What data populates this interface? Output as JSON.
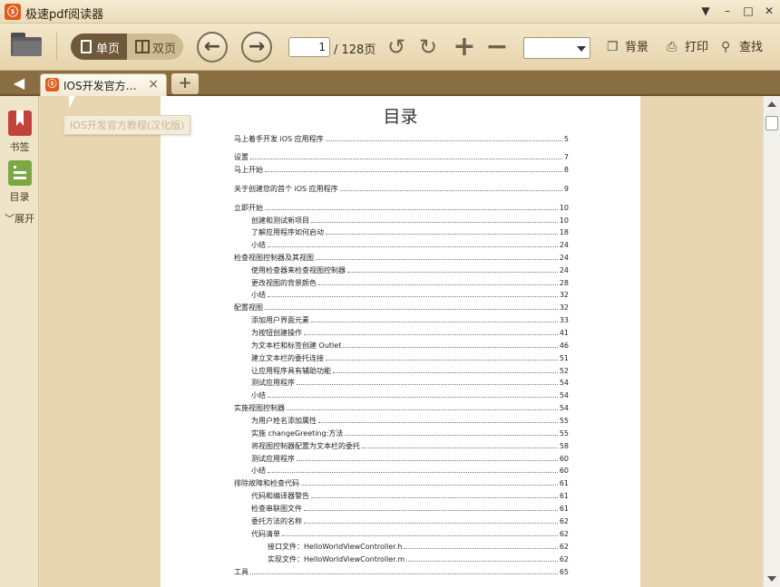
{
  "app": {
    "title": "极速pdf阅读器",
    "logo_char": "ⓢ"
  },
  "window_controls": {
    "menu": "▼",
    "minimize": "–",
    "maximize": "□",
    "close": "✕"
  },
  "toolbar": {
    "single_page_label": "单页",
    "double_page_label": "双页",
    "current_page": "1",
    "page_total": "/ 128页",
    "prev_glyph": "←",
    "next_glyph": "→",
    "rotate_left_glyph": "↺",
    "rotate_right_glyph": "↻",
    "zoom_in_glyph": "+",
    "zoom_out_glyph": "−",
    "background_label": "背景",
    "print_label": "打印",
    "find_label": "查找"
  },
  "tabs": {
    "collapse_glyph": "◀",
    "active_tab_label": "IOS开发官方…",
    "close_glyph": "×",
    "new_tab_glyph": "+",
    "tooltip": "IOS开发官方教程(汉化版)"
  },
  "left_panel": {
    "bookmark_label": "书签",
    "toc_label": "目录",
    "expand_label": "展开",
    "expand_glyph": "﹀"
  },
  "document": {
    "toc_heading": "目录",
    "entries": [
      {
        "title": "马上着手开发 iOS 应用程序",
        "page": "5",
        "indent": 0
      },
      {
        "title": "设置",
        "page": "7",
        "indent": 0
      },
      {
        "title": "马上开始",
        "page": "8",
        "indent": 0
      },
      {
        "title": "关于创建您的首个 iOS 应用程序",
        "page": "9",
        "indent": 0
      },
      {
        "title": "立即开始",
        "page": "10",
        "indent": 0
      },
      {
        "title": "创建和测试新项目",
        "page": "10",
        "indent": 1
      },
      {
        "title": "了解应用程序如何启动",
        "page": "18",
        "indent": 1
      },
      {
        "title": "小结",
        "page": "24",
        "indent": 1
      },
      {
        "title": "检查视图控制器及其视图",
        "page": "24",
        "indent": 0
      },
      {
        "title": "使用检查器来检查视图控制器",
        "page": "24",
        "indent": 1
      },
      {
        "title": "更改视图的背景颜色",
        "page": "28",
        "indent": 1
      },
      {
        "title": "小结",
        "page": "32",
        "indent": 1
      },
      {
        "title": "配置视图",
        "page": "32",
        "indent": 0
      },
      {
        "title": "添加用户界面元素",
        "page": "33",
        "indent": 1
      },
      {
        "title": "为按钮创建操作",
        "page": "41",
        "indent": 1
      },
      {
        "title": "为文本栏和标签创建 Outlet",
        "page": "46",
        "indent": 1
      },
      {
        "title": "建立文本栏的委托连接",
        "page": "51",
        "indent": 1
      },
      {
        "title": "让应用程序具有辅助功能",
        "page": "52",
        "indent": 1
      },
      {
        "title": "测试应用程序",
        "page": "54",
        "indent": 1
      },
      {
        "title": "小结",
        "page": "54",
        "indent": 1
      },
      {
        "title": "实施视图控制器",
        "page": "54",
        "indent": 0
      },
      {
        "title": "为用户姓名添加属性",
        "page": "55",
        "indent": 1
      },
      {
        "title": "实施 changeGreeting:方法",
        "page": "55",
        "indent": 1
      },
      {
        "title": "将视图控制器配置为文本栏的委托",
        "page": "58",
        "indent": 1
      },
      {
        "title": "测试应用程序",
        "page": "60",
        "indent": 1
      },
      {
        "title": "小结",
        "page": "60",
        "indent": 1
      },
      {
        "title": "排除故障和检查代码",
        "page": "61",
        "indent": 0
      },
      {
        "title": "代码和编译器警告",
        "page": "61",
        "indent": 1
      },
      {
        "title": "检查串联图文件",
        "page": "61",
        "indent": 1
      },
      {
        "title": "委托方法的名称",
        "page": "62",
        "indent": 1
      },
      {
        "title": "代码清单",
        "page": "62",
        "indent": 1
      },
      {
        "title": "接口文件：HelloWorldViewController.h",
        "page": "62",
        "indent": 2
      },
      {
        "title": "实现文件：HelloWorldViewController.m",
        "page": "62",
        "indent": 2
      },
      {
        "title": "工具",
        "page": "65",
        "indent": 0
      }
    ]
  },
  "colors": {
    "accent": "#e35a1d",
    "tabstrip": "#8a6e43",
    "page_bg": "#e8d6b0"
  }
}
